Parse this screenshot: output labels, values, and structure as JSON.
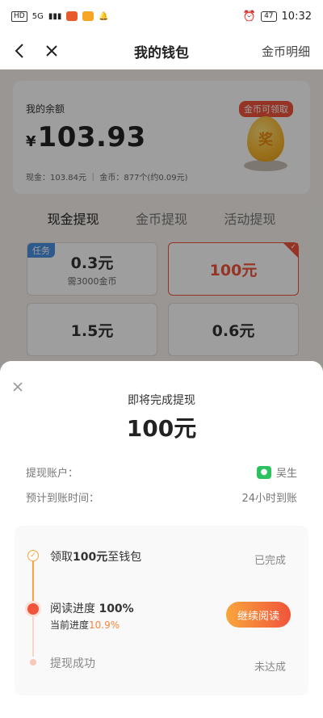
{
  "status_bar": {
    "network": "HD",
    "signal": "5G",
    "time": "10:32",
    "battery": "47"
  },
  "nav": {
    "title": "我的钱包",
    "right_link": "金币明细"
  },
  "balance": {
    "label": "我的余额",
    "currency": "¥",
    "amount": "103.93",
    "detail": "现金：103.84元  ｜  金币：877个(约0.09元)",
    "badge": "金币可领取",
    "egg_char": "奖"
  },
  "tabs": [
    "现金提现",
    "金币提现",
    "活动提现"
  ],
  "options": [
    {
      "amount": "0.3元",
      "note": "需3000金币",
      "tag": "任务"
    },
    {
      "amount": "100元"
    },
    {
      "amount": "1.5元"
    },
    {
      "amount": "0.6元"
    }
  ],
  "sheet": {
    "title": "即将完成提现",
    "amount": "100元",
    "account_label": "提现账户：",
    "account_name": "吴生",
    "eta_label": "预计到账时间：",
    "eta_value": "24小时到账"
  },
  "progress": {
    "step1_text_a": "领取",
    "step1_text_b": "100元",
    "step1_text_c": "至钱包",
    "step1_status": "已完成",
    "step2_text_a": "阅读进度",
    "step2_text_b": "100%",
    "step2_sub_label": "当前进度",
    "step2_sub_value": "10.9%",
    "step2_button": "继续阅读",
    "step3_text": "提现成功",
    "step3_status": "未达成"
  },
  "colors": {
    "accent": "#f0543b",
    "accent_orange": "#f7a23c",
    "wechat_green": "#2dc15f"
  }
}
